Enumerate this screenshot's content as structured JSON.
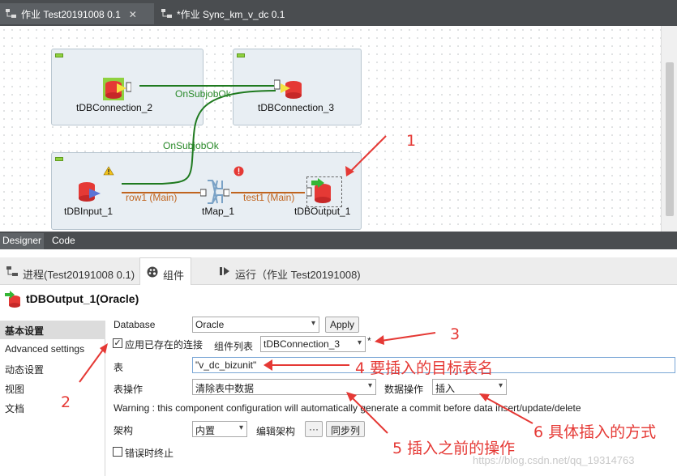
{
  "editor_tabs": [
    {
      "label": "作业 Test20191008 0.1",
      "close": "✕"
    },
    {
      "label": "*作业 Sync_km_v_dc 0.1"
    }
  ],
  "canvas": {
    "components": {
      "db_connection_2": "tDBConnection_2",
      "db_connection_3": "tDBConnection_3",
      "db_input_1": "tDBInput_1",
      "tmap_1": "tMap_1",
      "db_output_1": "tDBOutput_1"
    },
    "links": {
      "on_subjob_ok_1": "OnSubjobOk",
      "on_subjob_ok_2": "OnSubjobOk",
      "row1": "row1 (Main)",
      "test1": "test1 (Main)"
    },
    "connector_labels": {
      "trigger": "T",
      "main": "M",
      "out": "0"
    }
  },
  "annotations": {
    "a1": "1",
    "a2": "2",
    "a3": "3",
    "a4": "4  要插入的目标表名",
    "a5": "5 插入之前的操作",
    "a6": "6 具体插入的方式"
  },
  "designer_tabs": [
    "Designer",
    "Code"
  ],
  "view_tabs": [
    "进程(Test20191008 0.1)",
    "组件",
    "运行（作业 Test20191008)"
  ],
  "component_title": "tDBOutput_1(Oracle)",
  "nav": [
    "基本设置",
    "Advanced settings",
    "动态设置",
    "视图",
    "文档"
  ],
  "form": {
    "database_label": "Database",
    "database_value": "Oracle",
    "apply_label": "Apply",
    "use_existing_label": "应用已存在的连接",
    "use_existing_check": "✓",
    "component_list_label": "组件列表",
    "component_list_value": "tDBConnection_3",
    "required_mark": "*",
    "table_label": "表",
    "table_value": "\"v_dc_bizunit\"",
    "table_action_label": "表操作",
    "table_action_value": "清除表中数据",
    "data_action_label": "数据操作",
    "data_action_value": "插入",
    "warning": "Warning : this component configuration will automatically generate a commit before data insert/update/delete",
    "schema_label": "架构",
    "schema_value": "内置",
    "edit_schema_label": "编辑架构",
    "edit_schema_btn": "···",
    "sync_columns_label": "同步列",
    "die_on_error_label": "错误时终止",
    "arrow": "▾"
  },
  "watermark": "https://blog.csdn.net/qq_19314763",
  "colors": {
    "accent_red": "#e53935",
    "link_green": "#1f7a1f",
    "row_orange": "#c0641e"
  }
}
